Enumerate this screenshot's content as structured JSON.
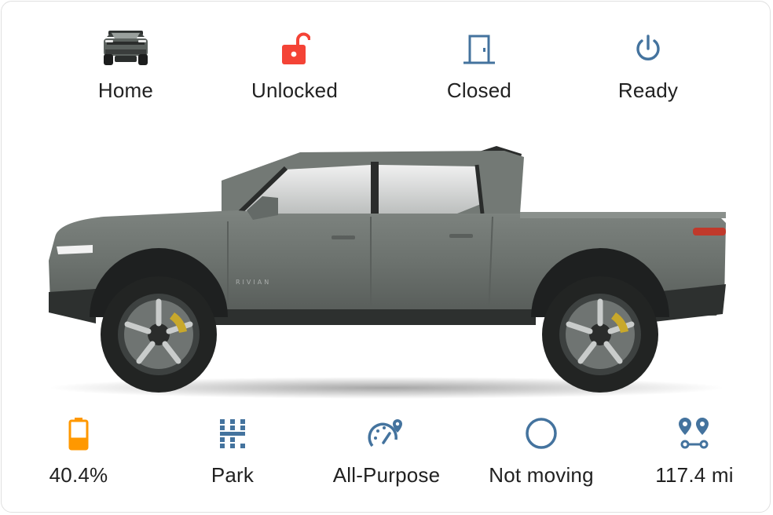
{
  "top_row": [
    {
      "key": "location",
      "label": "Home",
      "icon": "truck-icon"
    },
    {
      "key": "lock",
      "label": "Unlocked",
      "icon": "unlocked-padlock-icon",
      "color": "#f44336"
    },
    {
      "key": "doors",
      "label": "Closed",
      "icon": "closed-door-icon",
      "color": "#44739e"
    },
    {
      "key": "power",
      "label": "Ready",
      "icon": "power-icon",
      "color": "#44739e"
    }
  ],
  "bottom_row": [
    {
      "key": "battery",
      "label": "40.4%",
      "icon": "battery-icon",
      "color": "#ff9800",
      "level": 0.404
    },
    {
      "key": "gear",
      "label": "Park",
      "icon": "gear-shift-icon",
      "color": "#44739e"
    },
    {
      "key": "drive_mode",
      "label": "All-Purpose",
      "icon": "speedometer-pin-icon",
      "color": "#44739e"
    },
    {
      "key": "motion",
      "label": "Not moving",
      "icon": "circle-outline-icon",
      "color": "#44739e"
    },
    {
      "key": "range",
      "label": "117.4 mi",
      "icon": "map-marker-path-icon",
      "color": "#44739e"
    }
  ],
  "vehicle_image": {
    "brand_text": "RIVIAN",
    "body_color": "#6b716d"
  }
}
